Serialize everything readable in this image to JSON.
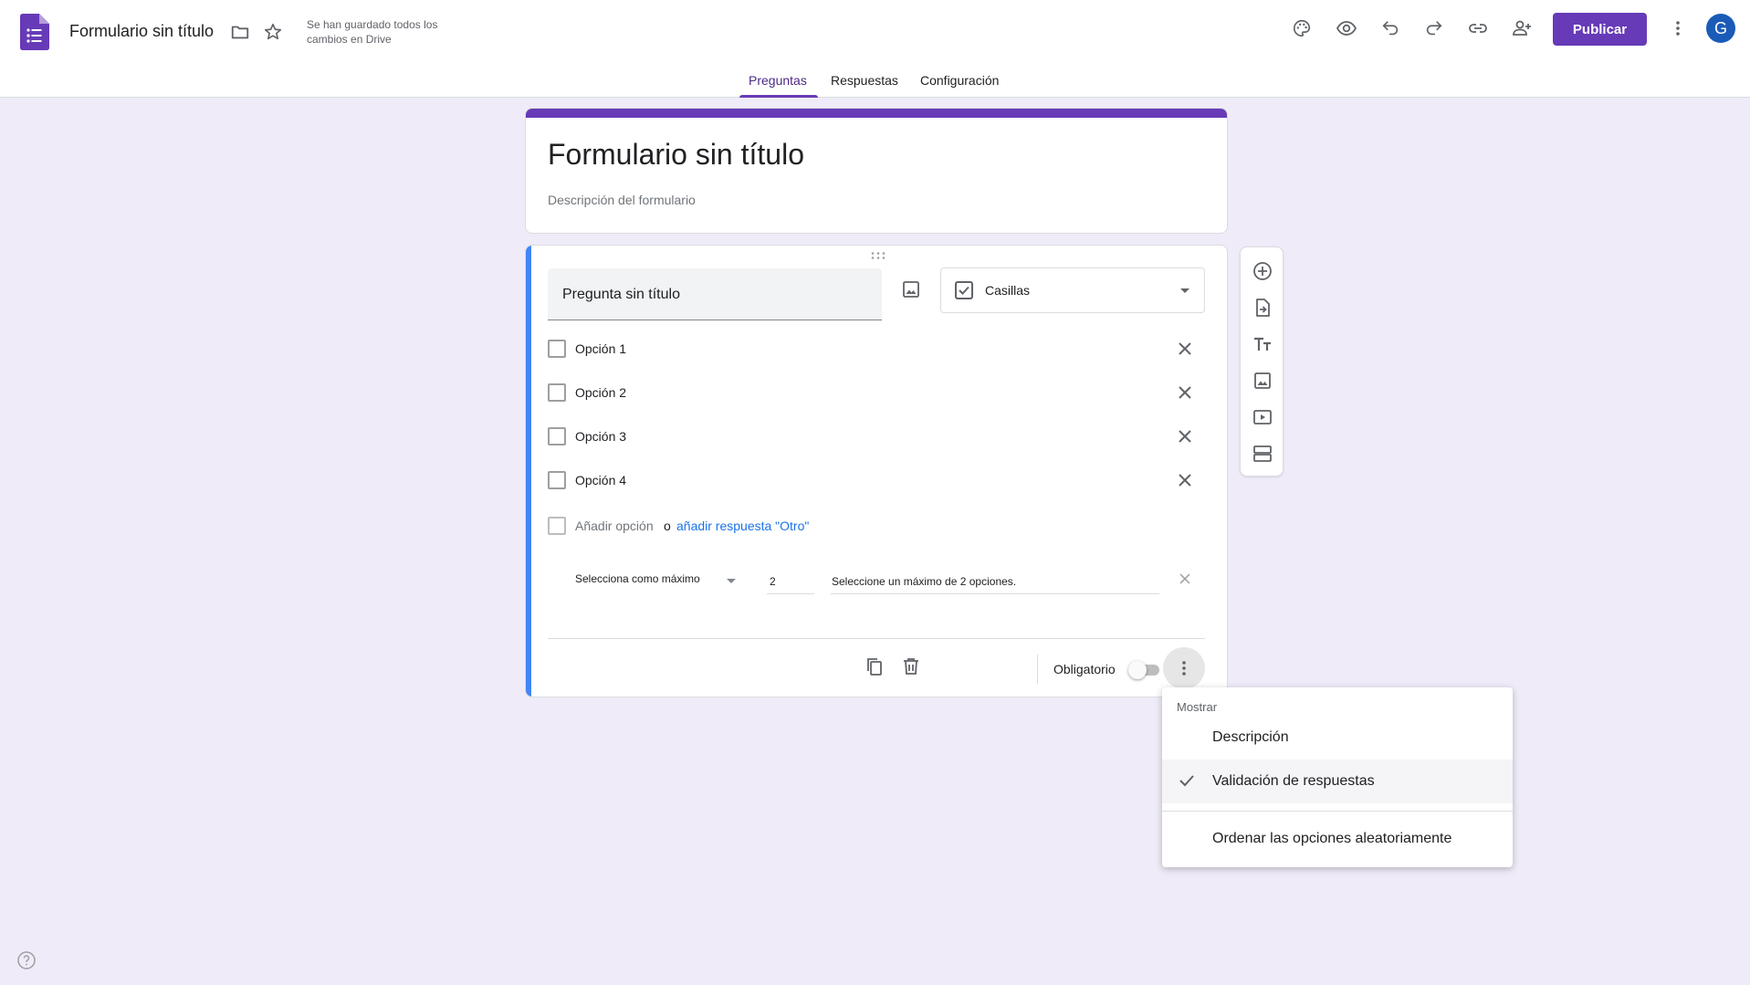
{
  "header": {
    "doc_title": "Formulario sin título",
    "save_status": "Se han guardado todos los cambios en Drive",
    "publish_label": "Publicar",
    "avatar_initial": "G",
    "icons": [
      "forms-logo-icon",
      "folder-icon",
      "star-icon",
      "palette-icon",
      "preview-eye-icon",
      "undo-icon",
      "redo-icon",
      "link-icon",
      "add-collaborator-icon",
      "more-vert-icon"
    ]
  },
  "tabs": [
    {
      "label": "Preguntas",
      "active": true
    },
    {
      "label": "Respuestas",
      "active": false
    },
    {
      "label": "Configuración",
      "active": false
    }
  ],
  "form": {
    "title": "Formulario sin título",
    "description_placeholder": "Descripción del formulario"
  },
  "question": {
    "title": "Pregunta sin título",
    "type": "Casillas",
    "options": [
      "Opción 1",
      "Opción 2",
      "Opción 3",
      "Opción 4"
    ],
    "add_option": "Añadir opción",
    "or_text": "o",
    "add_other": "añadir respuesta \"Otro\"",
    "validation": {
      "rule": "Selecciona como máximo",
      "number": "2",
      "error_message": "Seleccione un máximo de 2 opciones."
    },
    "required_label": "Obligatorio",
    "required": false
  },
  "side_toolbar": [
    "add-question-icon",
    "import-questions-icon",
    "add-title-icon",
    "add-image-icon",
    "add-video-icon",
    "add-section-icon"
  ],
  "menu": {
    "header": "Mostrar",
    "items": [
      {
        "label": "Descripción",
        "checked": false
      },
      {
        "label": "Validación de respuestas",
        "checked": true
      },
      {
        "label": "Ordenar las opciones aleatoriamente",
        "checked": false
      }
    ]
  },
  "colors": {
    "accent": "#673ab7",
    "question_bar": "#4285f4",
    "background": "#efebf8",
    "link": "#1a73e8"
  }
}
